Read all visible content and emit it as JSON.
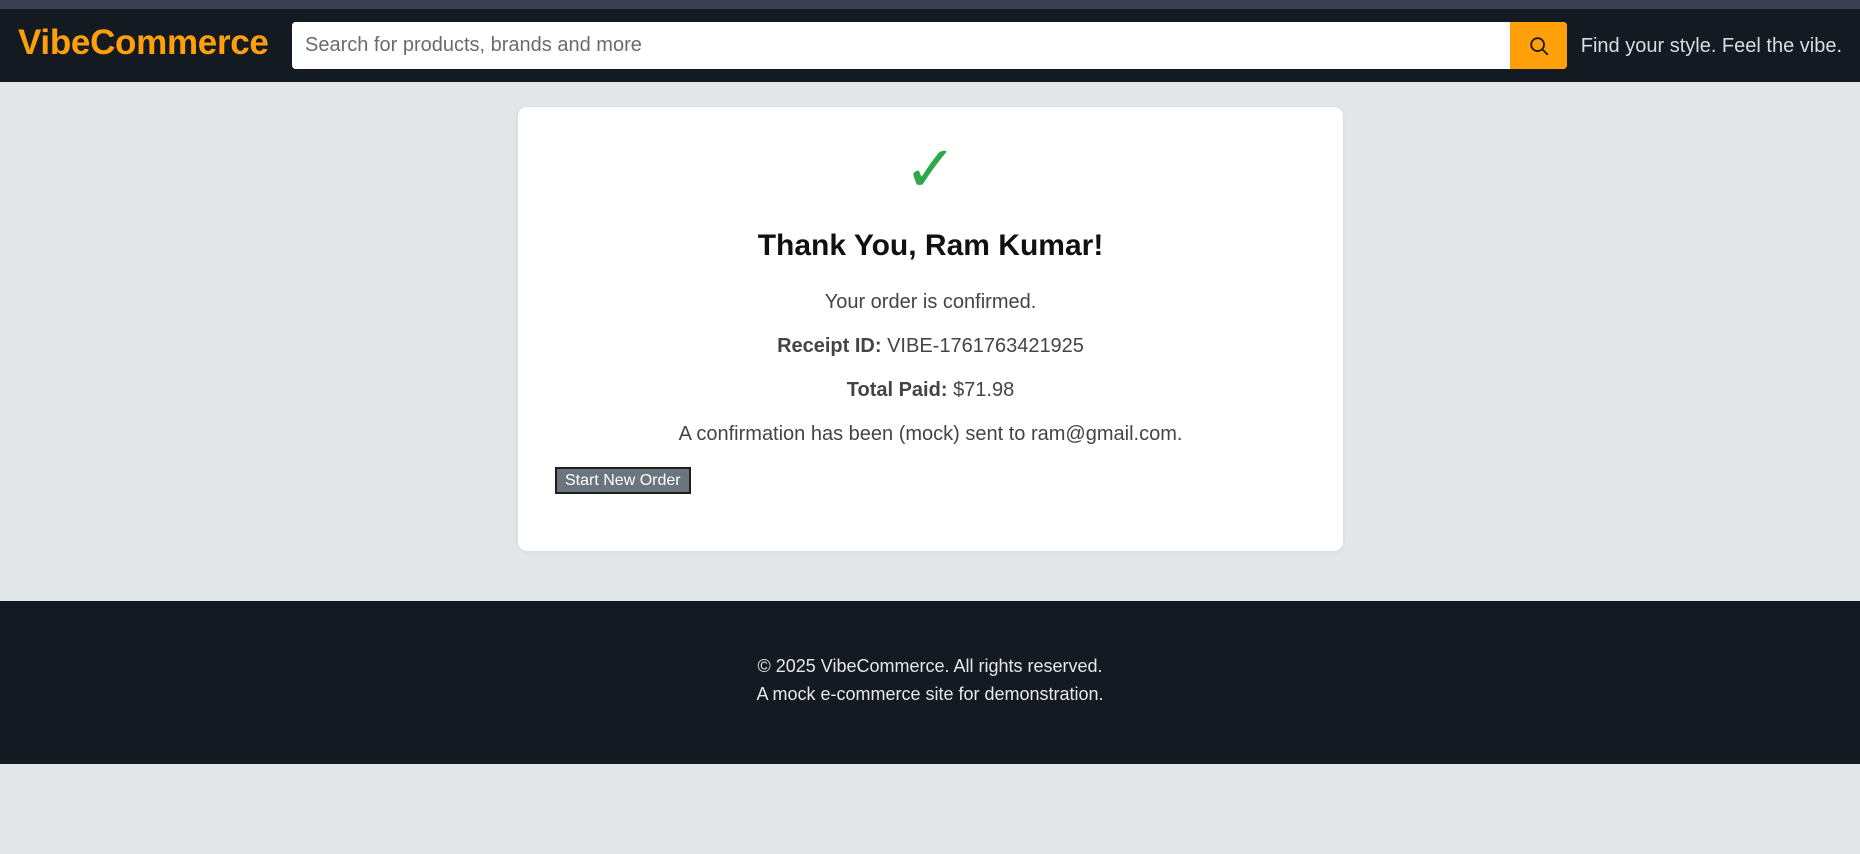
{
  "header": {
    "logo": "VibeCommerce",
    "search_placeholder": "Search for products, brands and more",
    "search_value": "",
    "search_button_icon": "search-icon",
    "tagline": "Find your style. Feel the vibe."
  },
  "confirmation": {
    "status_icon": "check-icon",
    "check_glyph": "✓",
    "title": "Thank You, Ram Kumar!",
    "message": "Your order is confirmed.",
    "receipt_label": "Receipt ID:",
    "receipt_id": "VIBE-1761763421925",
    "total_label": "Total Paid:",
    "total_value": "$71.98",
    "email_note": "A confirmation has been (mock) sent to ram@gmail.com.",
    "button_label": "Start New Order"
  },
  "footer": {
    "copyright": "© 2025 VibeCommerce. All rights reserved.",
    "note": "A mock e-commerce site for demonstration."
  },
  "colors": {
    "accent": "#ff9f0a",
    "header_bg": "#141a22",
    "page_bg": "#e2e6e8",
    "success": "#2ea84a",
    "button_bg": "#6c757d"
  }
}
